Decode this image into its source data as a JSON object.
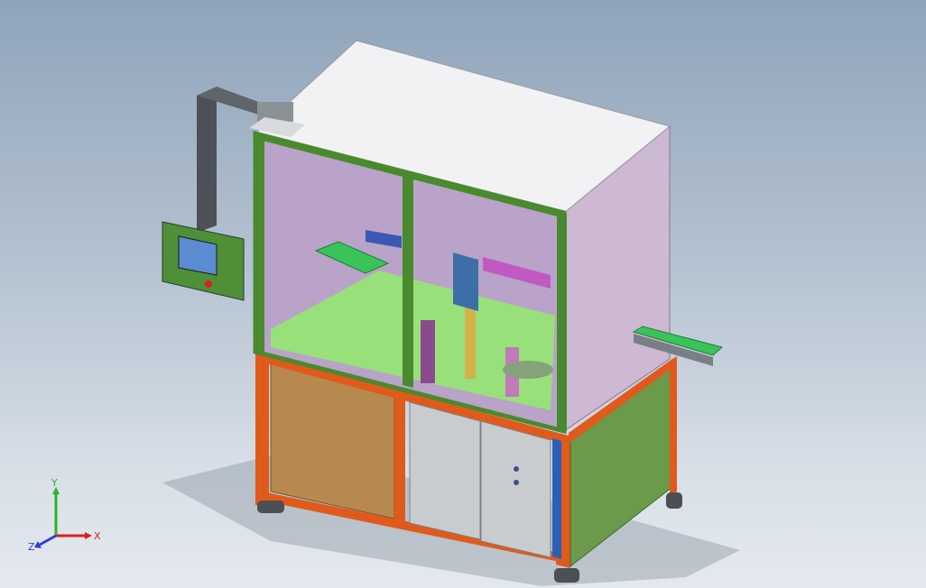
{
  "viewport": {
    "background_top": "#8fa4ba",
    "background_bottom": "#e4e9ee"
  },
  "model": {
    "frame_color": "#e05a1c",
    "enclosure_frame_color": "#4a8a2e",
    "side_panel_color": "#6a9a4a",
    "top_panel_color": "#f2f2f4",
    "glass_tint": "#b9a3c8",
    "door_panel_color": "#b8894f",
    "cabinet_door_color": "#c9cccf",
    "conveyor_color": "#39c45a",
    "interior_floor_color": "#98e07a",
    "hmi_screen_color": "#5b8bd0"
  },
  "triad": {
    "x_label": "X",
    "y_label": "Y",
    "z_label": "Z",
    "x_color": "#d91f1f",
    "y_color": "#2bb32b",
    "z_color": "#2a3fd6"
  }
}
